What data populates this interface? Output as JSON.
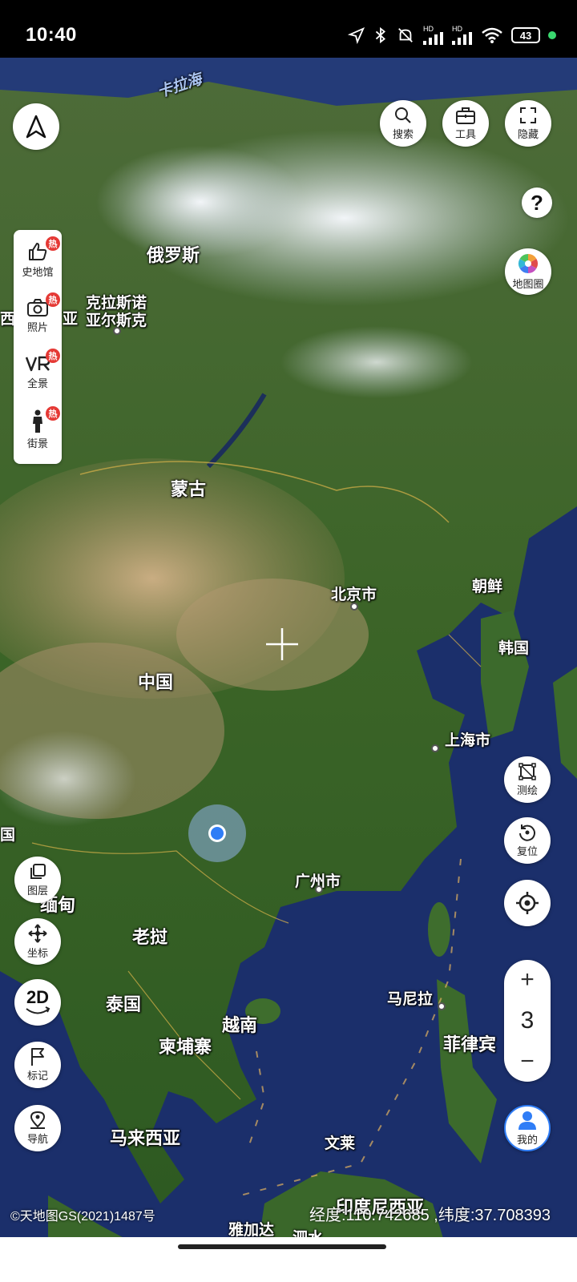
{
  "status_bar": {
    "time": "10:40",
    "battery": "43",
    "icons": [
      "location-arrow-icon",
      "bluetooth-icon",
      "mute-icon",
      "hd-signal-icon",
      "hd-signal-icon",
      "wifi-icon",
      "battery-icon",
      "green-dot-icon"
    ],
    "hd1": "HD",
    "hd2": "HD"
  },
  "top_buttons": {
    "search": "搜索",
    "tools": "工具",
    "hide": "隐藏",
    "help": "?",
    "map_circle": "地图圈"
  },
  "left_panel": {
    "items": [
      {
        "label": "史地馆",
        "badge": "热"
      },
      {
        "label": "照片",
        "badge": "热"
      },
      {
        "label": "全景",
        "badge": "热"
      },
      {
        "label": "街景",
        "badge": "热"
      }
    ]
  },
  "left_tools": {
    "layers": "图层",
    "coordinates": "坐标",
    "mode": "2D",
    "mark": "标记",
    "navigate": "导航"
  },
  "right_tools": {
    "measure": "测绘",
    "reset": "复位",
    "zoom_level": "3",
    "zoom_in": "+",
    "zoom_out": "−",
    "mine": "我的"
  },
  "map_labels": {
    "kara_sea": "卡拉海",
    "russia": "俄罗斯",
    "krasnoyarsk_1": "克拉斯诺",
    "krasnoyarsk_2": "亚尔斯克",
    "mongolia": "蒙古",
    "beijing": "北京市",
    "north_korea": "朝鲜",
    "south_korea": "韩国",
    "china": "中国",
    "shanghai": "上海市",
    "guangzhou": "广州市",
    "myanmar": "缅甸",
    "laos": "老挝",
    "thailand": "泰国",
    "vietnam": "越南",
    "cambodia": "柬埔寨",
    "manila": "马尼拉",
    "philippines": "菲律宾",
    "malaysia": "马来西亚",
    "brunei": "文莱",
    "indonesia": "印度尼西亚",
    "jakarta": "雅加达",
    "left_edge_1": "西",
    "left_edge_2": "亚",
    "left_edge_3": "国",
    "bottom_partial": "泗水"
  },
  "footer": {
    "copyright": "©天地图GS(2021)1487号",
    "coordinates": "经度:110.742685 ,纬度:37.708393"
  },
  "colors": {
    "ocean": "#1b2f6b",
    "land_green": "#3f6a2a",
    "desert": "#b69a6e",
    "snow": "#dfe6ee",
    "accent_blue": "#2f7df6",
    "hot_red": "#e53935"
  }
}
